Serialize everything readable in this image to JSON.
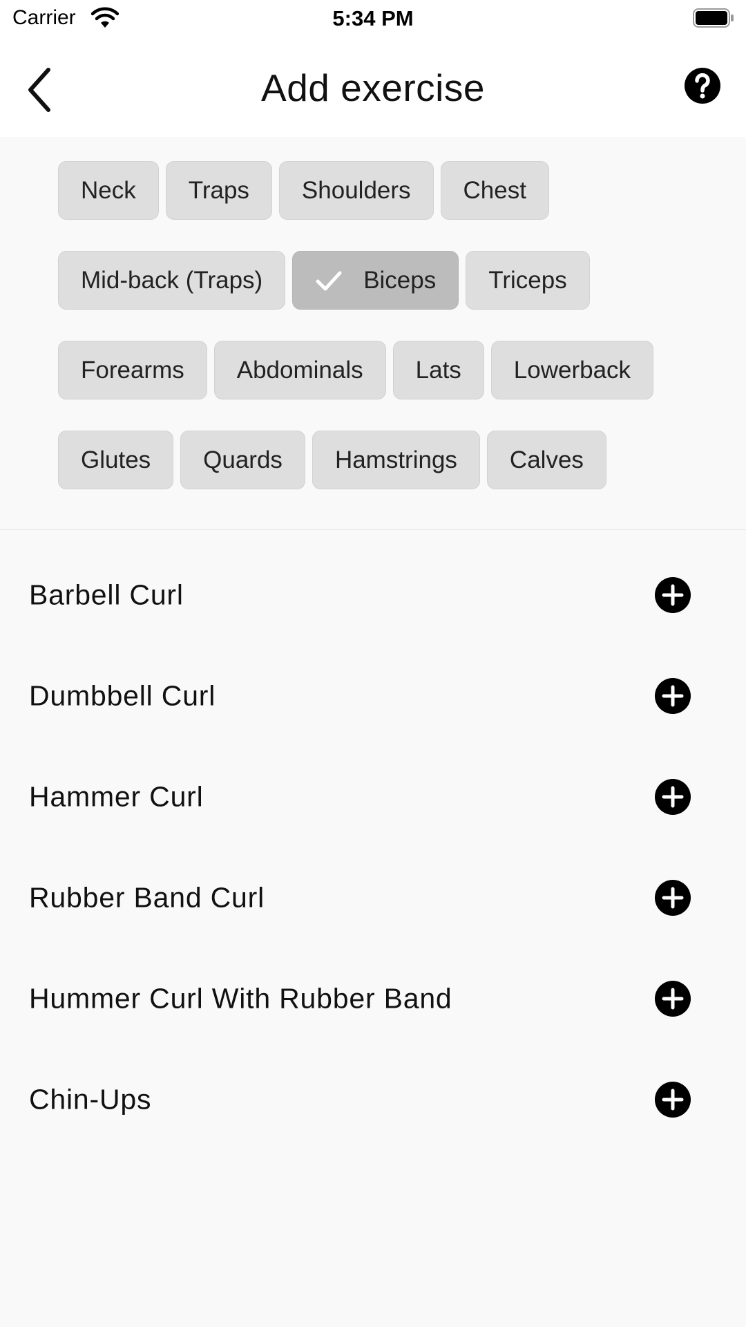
{
  "status_bar": {
    "carrier": "Carrier",
    "time": "5:34 PM",
    "icons": [
      "wifi-icon",
      "battery-icon"
    ]
  },
  "header": {
    "title": "Add exercise",
    "back_icon": "chevron-left-icon",
    "help_icon": "help-circle-icon"
  },
  "filters": {
    "rows": [
      [
        {
          "label": "Neck",
          "selected": false
        },
        {
          "label": "Traps",
          "selected": false
        },
        {
          "label": "Shoulders",
          "selected": false
        },
        {
          "label": "Chest",
          "selected": false
        }
      ],
      [
        {
          "label": "Mid-back (Traps)",
          "selected": false
        },
        {
          "label": "Biceps",
          "selected": true
        },
        {
          "label": "Triceps",
          "selected": false
        }
      ],
      [
        {
          "label": "Forearms",
          "selected": false
        },
        {
          "label": "Abdominals",
          "selected": false
        },
        {
          "label": "Lats",
          "selected": false
        },
        {
          "label": "Lowerback",
          "selected": false
        }
      ],
      [
        {
          "label": "Glutes",
          "selected": false
        },
        {
          "label": "Quards",
          "selected": false
        },
        {
          "label": "Hamstrings",
          "selected": false
        },
        {
          "label": "Calves",
          "selected": false
        }
      ]
    ],
    "selected_icon": "check-icon",
    "colors": {
      "chip": "#dedede",
      "chip_selected": "#bcbcbc"
    }
  },
  "exercises": {
    "items": [
      {
        "label": "Barbell Curl"
      },
      {
        "label": "Dumbbell Curl"
      },
      {
        "label": "Hammer Curl"
      },
      {
        "label": "Rubber Band Curl"
      },
      {
        "label": "Hummer Curl With Rubber Band"
      },
      {
        "label": "Chin-Ups"
      }
    ],
    "action_icon": "add-circle-icon"
  }
}
